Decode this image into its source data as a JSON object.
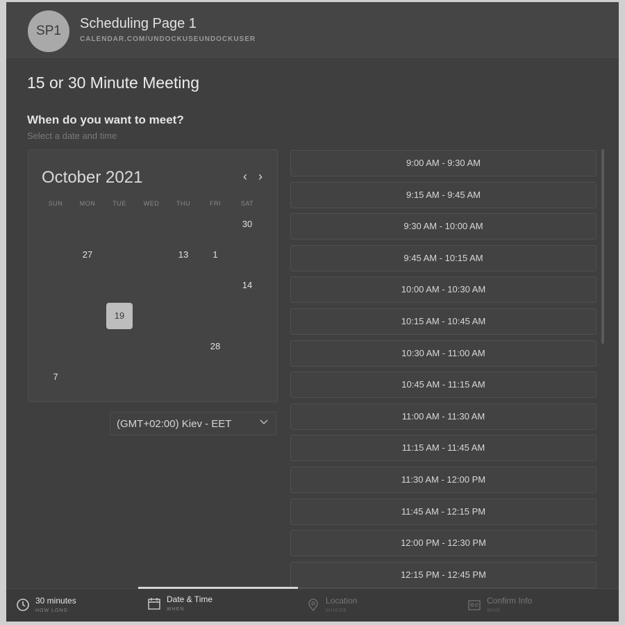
{
  "header": {
    "avatar": "SP1",
    "page_name": "Scheduling Page 1",
    "url": "CALENDAR.COM/UNDOCKUSEUNDOCKUSER"
  },
  "meeting": {
    "title": "15 or 30 Minute Meeting",
    "question": "When do you want to meet?",
    "subtitle": "Select a date and time"
  },
  "calendar": {
    "month": "October 2021",
    "prev_icon": "chevron-left-icon",
    "next_icon": "chevron-right-icon",
    "days_of_week": [
      "SUN",
      "MON",
      "TUE",
      "WED",
      "THU",
      "FRI",
      "SAT"
    ],
    "weeks": [
      [
        "",
        "",
        "",
        "",
        "",
        "",
        "30"
      ],
      [
        "",
        "27",
        "",
        "",
        "13",
        "1",
        ""
      ],
      [
        "",
        "",
        "",
        "",
        "",
        "",
        "14"
      ],
      [
        "",
        "",
        "19",
        "",
        "",
        "",
        ""
      ],
      [
        "",
        "",
        "",
        "",
        "",
        "28",
        ""
      ],
      [
        "7",
        "",
        "",
        "",
        "",
        "",
        ""
      ]
    ],
    "selected": "19"
  },
  "timezone": {
    "value": "(GMT+02:00) Kiev - EET",
    "icon": "chevron-down-icon"
  },
  "time_slots": [
    "9:00 AM - 9:30 AM",
    "9:15 AM - 9:45 AM",
    "9:30 AM - 10:00 AM",
    "9:45 AM - 10:15 AM",
    "10:00 AM - 10:30 AM",
    "10:15 AM - 10:45 AM",
    "10:30 AM - 11:00 AM",
    "10:45 AM - 11:15 AM",
    "11:00 AM - 11:30 AM",
    "11:15 AM - 11:45 AM",
    "11:30 AM - 12:00 PM",
    "11:45 AM - 12:15 PM",
    "12:00 PM - 12:30 PM",
    "12:15 PM - 12:45 PM"
  ],
  "footer": {
    "steps": [
      {
        "label": "30 minutes",
        "sub": "HOW LONG",
        "icon": "clock-icon",
        "active": true
      },
      {
        "label": "Date & Time",
        "sub": "WHEN",
        "icon": "calendar-icon",
        "active": true
      },
      {
        "label": "Location",
        "sub": "WHERE",
        "icon": "location-pin-icon",
        "active": false
      },
      {
        "label": "Confirm Info",
        "sub": "WHO",
        "icon": "person-card-icon",
        "active": false
      }
    ]
  }
}
